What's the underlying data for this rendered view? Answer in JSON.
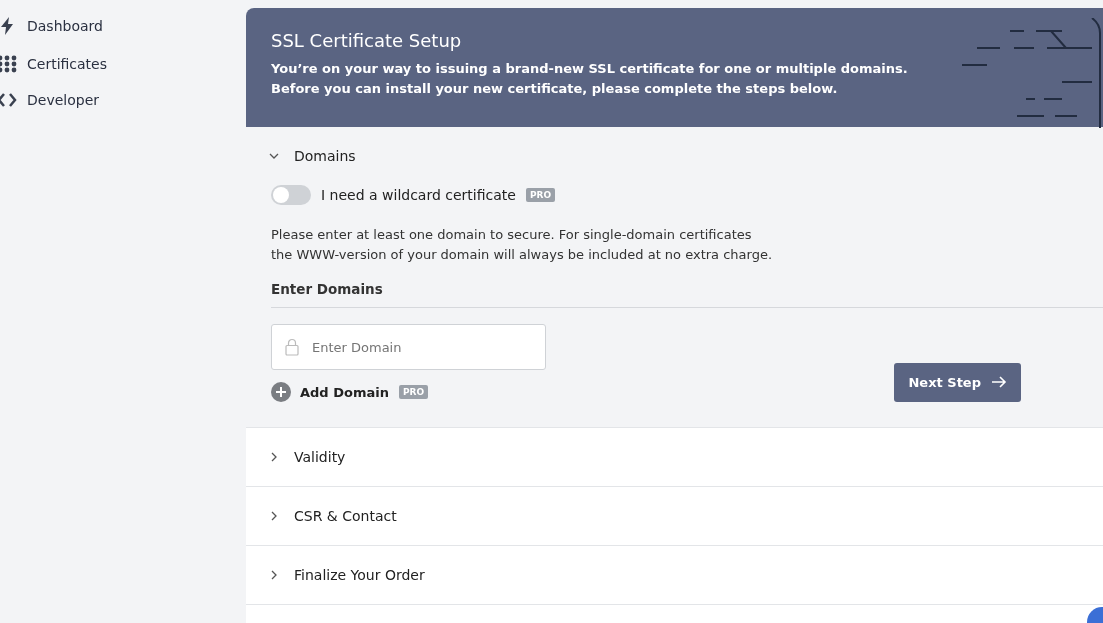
{
  "sidebar": {
    "items": [
      {
        "label": "Dashboard"
      },
      {
        "label": "Certificates"
      },
      {
        "label": "Developer"
      }
    ]
  },
  "header": {
    "title": "SSL Certificate Setup",
    "subtitle": "You’re on your way to issuing a brand-new SSL certificate for one or multiple domains.\nBefore you can install your new certificate, please complete the steps below."
  },
  "sections": [
    {
      "title": "Domains",
      "expanded": true
    },
    {
      "title": "Validity",
      "expanded": false
    },
    {
      "title": "CSR & Contact",
      "expanded": false
    },
    {
      "title": "Finalize Your Order",
      "expanded": false
    }
  ],
  "domains": {
    "wildcard": {
      "label": "I need a wildcard certificate",
      "on": false,
      "badge": "PRO"
    },
    "info": "Please enter at least one domain to secure. For single-domain certificates\nthe WWW-version of your domain will always be included at no extra charge.",
    "heading": "Enter Domains",
    "field": {
      "placeholder": "Enter Domain"
    },
    "add": {
      "label": "Add Domain",
      "badge": "PRO"
    },
    "next": "Next Step"
  }
}
